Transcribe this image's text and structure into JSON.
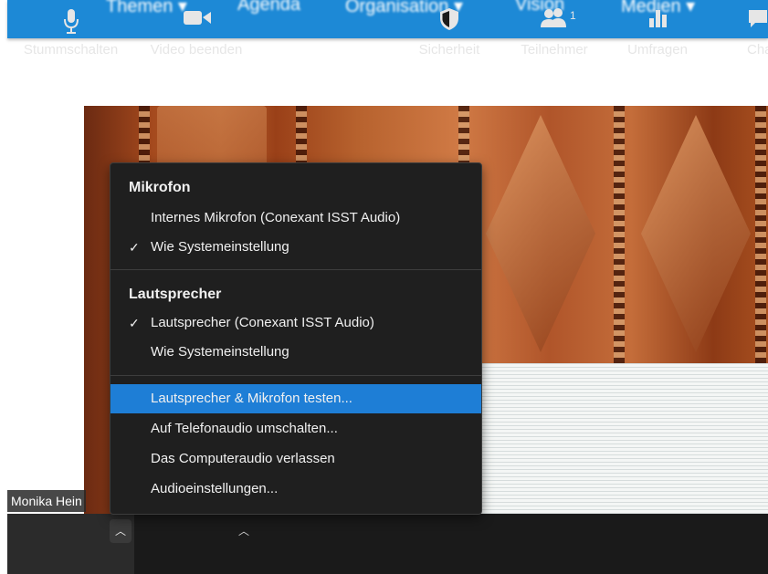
{
  "topnav": {
    "items": [
      "Themen ▾",
      "Agenda",
      "Organisation ▾",
      "Vision",
      "Medien ▾"
    ]
  },
  "video": {
    "participant_name": "Monika Hein"
  },
  "menu": {
    "mic_header": "Mikrofon",
    "mic_items": [
      {
        "label": "Internes Mikrofon (Conexant ISST Audio)",
        "checked": false
      },
      {
        "label": "Wie Systemeinstellung",
        "checked": true
      }
    ],
    "speaker_header": "Lautsprecher",
    "speaker_items": [
      {
        "label": "Lautsprecher (Conexant ISST Audio)",
        "checked": true
      },
      {
        "label": "Wie Systemeinstellung",
        "checked": false
      }
    ],
    "actions": [
      {
        "label": "Lautsprecher & Mikrofon testen...",
        "selected": true
      },
      {
        "label": "Auf Telefonaudio umschalten...",
        "selected": false
      },
      {
        "label": "Das Computeraudio verlassen",
        "selected": false
      },
      {
        "label": "Audioeinstellungen...",
        "selected": false
      }
    ],
    "check_glyph": "✓"
  },
  "toolbar": {
    "mute": "Stummschalten",
    "video": "Video beenden",
    "security": "Sicherheit",
    "participants": "Teilnehmer",
    "participants_count": "1",
    "polls": "Umfragen",
    "chat": "Chat"
  },
  "colors": {
    "nav_blue": "#1d89d6",
    "menu_bg": "#1f1f1f",
    "selection_blue": "#1e7ed6",
    "toolbar_bg": "#1a1a1a"
  }
}
